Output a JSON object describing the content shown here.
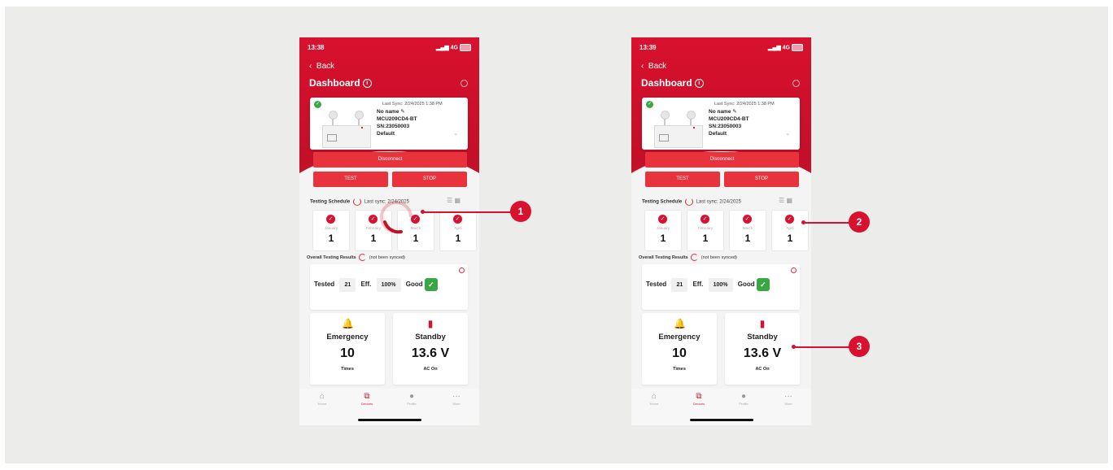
{
  "phone_left": {
    "status_time": "13:38",
    "status_signal": "4G",
    "back_label": "Back",
    "title": "Dashboard",
    "device": {
      "last_sync": "Last Sync: 2/24/2025 1:38 PM",
      "name": "No name",
      "model": "MCU209CD4-BT",
      "serial": "SN:23050003",
      "profile": "Default"
    },
    "disconnect_label": "Disconnect",
    "test_label": "TEST",
    "stop_label": "STOP",
    "schedule": {
      "label": "Testing Schedule",
      "sync_text": "Last sync: 2/24/2025"
    },
    "months": [
      {
        "name": "January",
        "count": "1"
      },
      {
        "name": "February",
        "count": "1"
      },
      {
        "name": "March",
        "count": "1"
      },
      {
        "name": "April",
        "count": "1"
      }
    ],
    "overall": {
      "label": "Overall Testing Results",
      "note": "(not been synced)"
    },
    "results": {
      "tested_label": "Tested",
      "tested_value": "21",
      "eff_label": "Eff.",
      "eff_value": "100%",
      "status": "Good"
    },
    "emergency": {
      "title": "Emergency",
      "value": "10",
      "sub": "Times"
    },
    "standby": {
      "title": "Standby",
      "value": "13.6 V",
      "sub": "AC On"
    },
    "tabs": [
      "Home",
      "Devices",
      "Profile",
      "More"
    ]
  },
  "phone_right": {
    "status_time": "13:39",
    "status_signal": "4G",
    "back_label": "Back",
    "title": "Dashboard",
    "device": {
      "last_sync": "Last Sync: 2/24/2025 1:38 PM",
      "name": "No name",
      "model": "MCU209CD4-BT",
      "serial": "SN:23050003",
      "profile": "Default"
    },
    "disconnect_label": "Disconnect",
    "test_label": "TEST",
    "stop_label": "STOP",
    "schedule": {
      "label": "Testing Schedule",
      "sync_text": "Last sync: 2/24/2025"
    },
    "months": [
      {
        "name": "January",
        "count": "1"
      },
      {
        "name": "February",
        "count": "1"
      },
      {
        "name": "March",
        "count": "1"
      },
      {
        "name": "April",
        "count": "1"
      }
    ],
    "overall": {
      "label": "Overall Testing Results",
      "note": "(not been synced)"
    },
    "results": {
      "tested_label": "Tested",
      "tested_value": "21",
      "eff_label": "Eff.",
      "eff_value": "100%",
      "status": "Good"
    },
    "emergency": {
      "title": "Emergency",
      "value": "10",
      "sub": "Times"
    },
    "standby": {
      "title": "Standby",
      "value": "13.6 V",
      "sub": "AC On"
    },
    "tabs": [
      "Home",
      "Devices",
      "Profile",
      "More"
    ]
  },
  "callouts": [
    "1",
    "2",
    "3"
  ],
  "colors": {
    "brand_red": "#d8112e",
    "good_green": "#3aa745",
    "background": "#ececea"
  }
}
